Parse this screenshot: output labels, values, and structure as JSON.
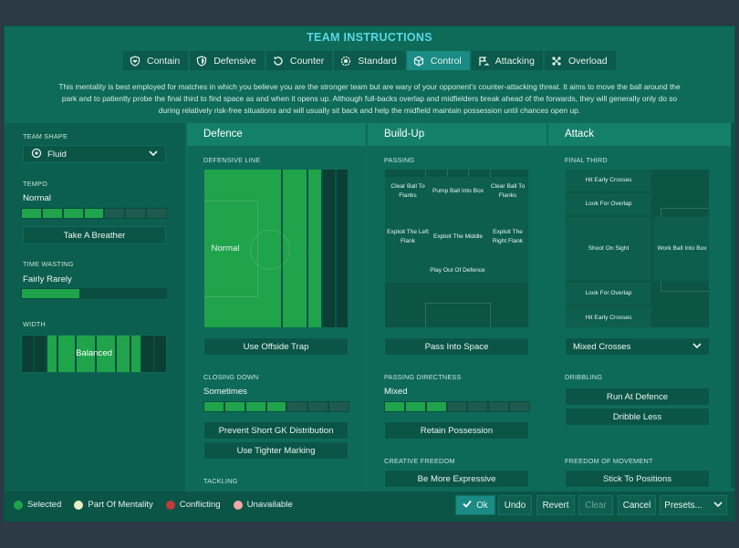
{
  "title": "TEAM INSTRUCTIONS",
  "colors": {
    "selected": "#1fa34b",
    "part_of_mentality": "#e8f0c2",
    "conflicting": "#c23a3a",
    "unavailable": "#f0a8a8",
    "accent": "#58d7e6"
  },
  "tabs": [
    {
      "label": "Contain",
      "icon": "shield-heart-icon"
    },
    {
      "label": "Defensive",
      "icon": "shield-icon"
    },
    {
      "label": "Counter",
      "icon": "counter-arrow-icon"
    },
    {
      "label": "Standard",
      "icon": "gear-ball-icon"
    },
    {
      "label": "Control",
      "icon": "cube-icon",
      "active": true
    },
    {
      "label": "Attacking",
      "icon": "arrow-flag-icon"
    },
    {
      "label": "Overload",
      "icon": "network-icon"
    }
  ],
  "description": [
    "This mentality is best employed for matches in which you believe you are the stronger team but are wary of your opponent's counter-attacking threat. It aims to move the ball around the",
    "park and to patiently probe the final third to find space as and when it opens up. Although full-backs overlap and midfielders break ahead of the forwards, they will generally only do so",
    "during relatively risk-free situations and will usually sit back and help the midfield maintain possession until chances open up."
  ],
  "left": {
    "team_shape_label": "TEAM SHAPE",
    "team_shape_value": "Fluid",
    "tempo_label": "TEMPO",
    "tempo_value": "Normal",
    "tempo_level": 0.6,
    "take_breather": "Take A Breather",
    "time_wasting_label": "TIME WASTING",
    "time_wasting_value": "Fairly Rarely",
    "time_wasting_level": 0.4,
    "width_label": "WIDTH",
    "width_value": "Balanced"
  },
  "defence": {
    "header": "Defence",
    "defensive_line_label": "DEFENSIVE LINE",
    "defensive_line_value": "Normal",
    "offside_trap": "Use Offside Trap",
    "closing_down_label": "CLOSING DOWN",
    "closing_down_value": "Sometimes",
    "closing_down_level": 0.5,
    "prevent_gk": "Prevent Short GK Distribution",
    "tighter_marking": "Use Tighter Marking",
    "tackling_label": "TACKLING"
  },
  "buildup": {
    "header": "Build-Up",
    "passing_label": "PASSING",
    "cells": {
      "clear_left": "Clear Ball To Flanks",
      "pump": "Pump Ball Into Box",
      "clear_right": "Clear Ball To Flanks",
      "exploit_left": "Exploit The Left Flank",
      "exploit_middle": "Exploit The Middle",
      "exploit_right": "Exploit The Right Flank",
      "play_out": "Play Out Of Defence"
    },
    "pass_into_space": "Pass Into Space",
    "directness_label": "PASSING DIRECTNESS",
    "directness_value": "Mixed",
    "directness_level": 0.45,
    "retain": "Retain Possession",
    "creative_label": "CREATIVE FREEDOM",
    "expressive": "Be More Expressive"
  },
  "attack": {
    "header": "Attack",
    "final_third_label": "FINAL THIRD",
    "cells": {
      "hit_top": "Hit Early Crosses",
      "overlap_top": "Look For Overlap",
      "shoot": "Shoot On Sight",
      "work_ball": "Work Ball Into Box",
      "overlap_bottom": "Look For Overlap",
      "hit_bottom": "Hit Early Crosses"
    },
    "crosses_value": "Mixed Crosses",
    "dribbling_label": "DRIBBLING",
    "run_at_defence": "Run At Defence",
    "dribble_less": "Dribble Less",
    "freedom_label": "FREEDOM OF MOVEMENT",
    "stick_positions": "Stick To Positions"
  },
  "legend": {
    "selected": "Selected",
    "part": "Part Of Mentality",
    "conflicting": "Conflicting",
    "unavailable": "Unavailable"
  },
  "footer": {
    "ok": "Ok",
    "undo": "Undo",
    "revert": "Revert",
    "clear": "Clear",
    "cancel": "Cancel",
    "presets": "Presets..."
  }
}
